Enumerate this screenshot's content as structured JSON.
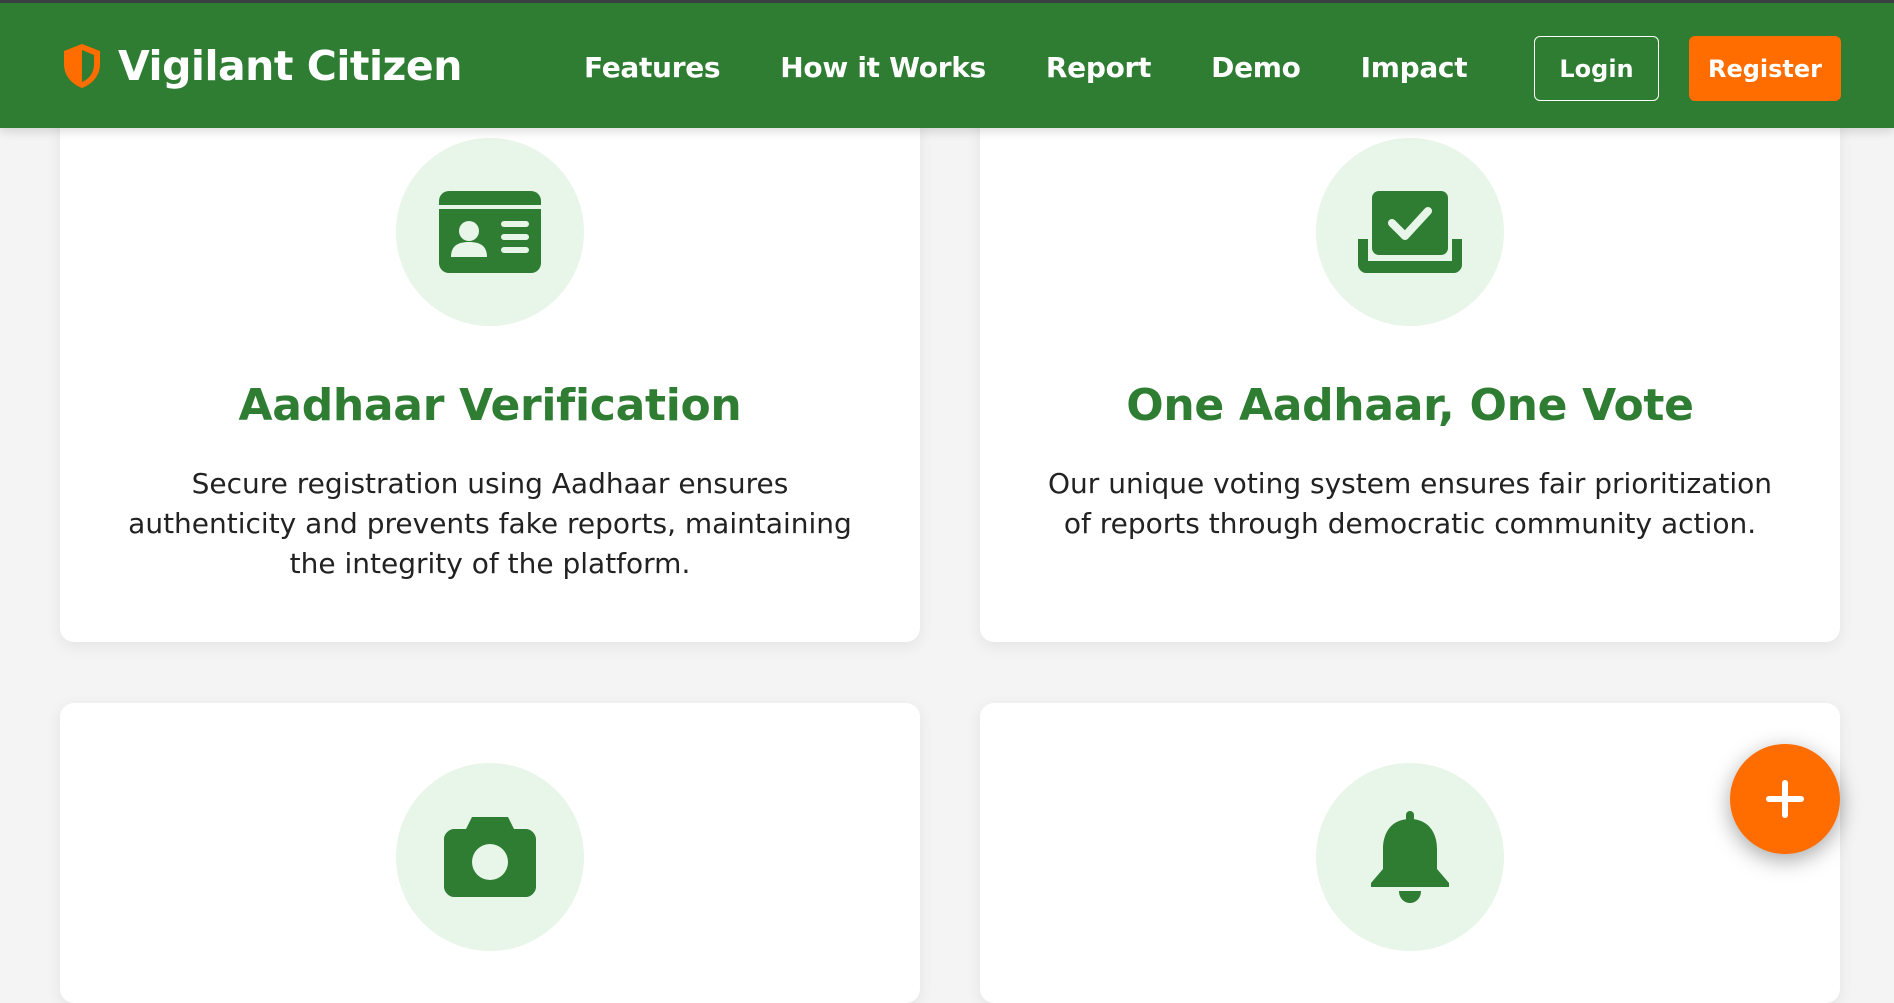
{
  "brand": {
    "name": "Vigilant Citizen",
    "icon": "shield-icon",
    "colors": {
      "primary": "#2e7d32",
      "accent": "#ff6d00",
      "icon_bg": "#e8f5e9"
    }
  },
  "nav": {
    "links": [
      {
        "label": "Features"
      },
      {
        "label": "How it Works"
      },
      {
        "label": "Report"
      },
      {
        "label": "Demo"
      },
      {
        "label": "Impact"
      }
    ],
    "login_label": "Login",
    "register_label": "Register"
  },
  "features": [
    {
      "icon": "id-card-icon",
      "title": "Aadhaar Verification",
      "description": "Secure registration using Aadhaar ensures authenticity and prevents fake reports, maintaining the integrity of the platform."
    },
    {
      "icon": "vote-box-icon",
      "title": "One Aadhaar, One Vote",
      "description": "Our unique voting system ensures fair prioritization of reports through democratic community action."
    },
    {
      "icon": "camera-icon"
    },
    {
      "icon": "bell-icon"
    }
  ],
  "fab": {
    "icon": "plus-icon"
  }
}
